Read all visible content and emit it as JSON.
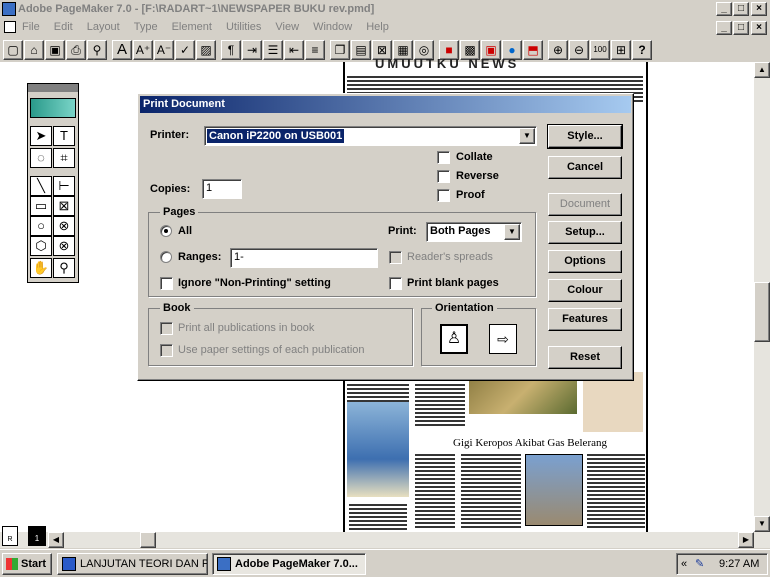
{
  "window": {
    "title": "Adobe PageMaker 7.0 - [F:\\RADART~1\\NEWSPAPER BUKU rev.pmd]"
  },
  "menu": [
    "File",
    "Edit",
    "Layout",
    "Type",
    "Element",
    "Utilities",
    "View",
    "Window",
    "Help"
  ],
  "newspaper": {
    "masthead": "UMUUTKU NEWS",
    "headline": "Gigi Keropos Akibat Gas Belerang"
  },
  "dialog": {
    "title": "Print Document",
    "printer_label": "Printer:",
    "printer_value": "Canon iP2200 on USB001",
    "collate": "Collate",
    "reverse": "Reverse",
    "proof": "Proof",
    "copies_label": "Copies:",
    "copies_value": "1",
    "pages_group": "Pages",
    "all": "All",
    "ranges": "Ranges:",
    "ranges_value": "1-",
    "ignore": "Ignore \"Non-Printing\" setting",
    "print_label": "Print:",
    "print_value": "Both Pages",
    "readers": "Reader's spreads",
    "blank": "Print blank pages",
    "book_group": "Book",
    "book_all": "Print all publications in book",
    "book_paper": "Use paper settings of each publication",
    "orientation_group": "Orientation",
    "buttons": {
      "style": "Style...",
      "cancel": "Cancel",
      "document": "Document",
      "setup": "Setup...",
      "options": "Options",
      "colour": "Colour",
      "features": "Features",
      "reset": "Reset"
    }
  },
  "taskbar": {
    "start": "Start",
    "task1": "LANJUTAN TEORI DAN P...",
    "task2": "Adobe PageMaker 7.0...",
    "clock": "9:27 AM"
  }
}
